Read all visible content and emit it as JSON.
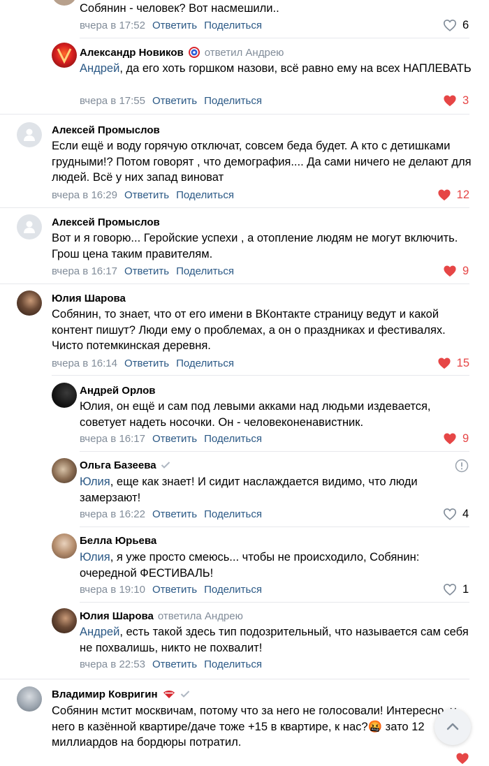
{
  "actions": {
    "reply": "Ответить",
    "share": "Поделиться"
  },
  "comments": [
    {
      "text": "Собянин - человек? Вот насмешили..",
      "date": "вчера в 17:52",
      "likes": "6",
      "liked": false
    },
    {
      "name": "Александр Новиков",
      "replied": "ответил Андрею",
      "mention": "Андрей",
      "text": ", да его хоть горшком назови, всё равно ему на всех НАПЛЕВАТЬ",
      "date": "вчера в 17:55",
      "likes": "3",
      "liked": true
    },
    {
      "name": "Алексей Промыслов",
      "text": "Если ещё и воду горячую отключат, совсем беда будет. А кто с детишками грудными!? Потом говорят , что демография.... Да сами ничего не делают для людей. Всё у них запад виноват",
      "date": "вчера в 16:29",
      "likes": "12",
      "liked": true
    },
    {
      "name": "Алексей Промыслов",
      "text": "Вот и я говорю... Геройские успехи , а отопление людям не могут включить. Грош цена таким правителям.",
      "date": "вчера в 16:17",
      "likes": "9",
      "liked": true
    },
    {
      "name": "Юлия Шарова",
      "text": "Собянин, то знает, что от его имени в ВКонтакте страницу ведут и какой контент пишут? Люди ему о проблемах, а он о праздниках и фестивалях. Чисто потемкинская деревня.",
      "date": "вчера в 16:14",
      "likes": "15",
      "liked": true
    },
    {
      "name": "Андрей Орлов",
      "text": "Юлия, он ещё и сам под левыми акками над людьми издевается, советует надеть носочки. Он - человеконенавистник.",
      "date": "вчера в 16:17",
      "likes": "9",
      "liked": true
    },
    {
      "name": "Ольга Базеева",
      "mention": "Юлия",
      "text": ", еще как знает! И сидит наслаждается видимо, что люди замерзают!",
      "date": "вчера в 16:22",
      "likes": "4",
      "liked": false
    },
    {
      "name": "Белла Юрьева",
      "mention": "Юлия",
      "text": ", я уже просто смеюсь... чтобы не происходило, Собянин: очередной ФЕСТИВАЛЬ!",
      "date": "вчера в 19:10",
      "likes": "1",
      "liked": false
    },
    {
      "name": "Юлия Шарова",
      "replied": "ответила Андрею",
      "mention": "Андрей",
      "text": ", есть такой здесь тип подозрительный, что называется сам себя не похвалишь, никто не похвалит!",
      "date": "вчера в 22:53"
    },
    {
      "name": "Владимир Ковригин",
      "text": "Собянин мстит москвичам, потому что за него не голосовали! Интересно, у него в казённой квартире/даче тоже +15 в квартире, к нас?🤬 зато 12 миллиардов на бордюры потратил."
    }
  ],
  "colors": {
    "link": "#2a5885",
    "muted": "#818c99",
    "like_active": "#e64646",
    "separator": "#e7e8ec"
  }
}
